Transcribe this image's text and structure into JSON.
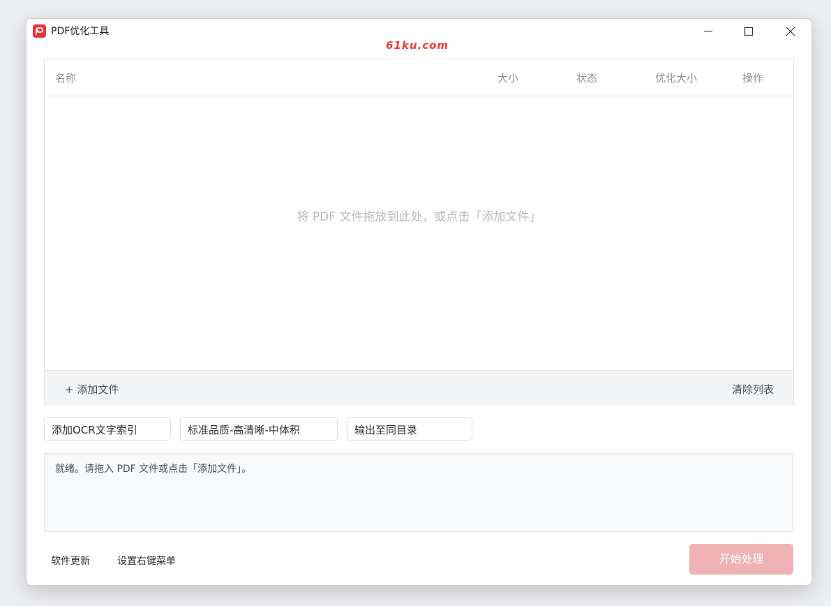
{
  "window": {
    "title": "PDF优化工具",
    "icon": "pdf-tool-logo",
    "watermark": "61ku.com"
  },
  "table": {
    "columns": [
      "名称",
      "大小",
      "状态",
      "优化大小",
      "操作"
    ],
    "rows": [],
    "empty_hint": "将 PDF 文件拖放到此处，或点击「添加文件」"
  },
  "list_actions": {
    "add_file": "+ 添加文件",
    "clear_list": "清除列表"
  },
  "options": {
    "ocr": "添加OCR文字索引",
    "quality": "标准品质-高清晰-中体积",
    "output": "输出至同目录"
  },
  "log": {
    "message": "就绪。请拖入 PDF 文件或点击「添加文件」。"
  },
  "footer": {
    "update_link": "软件更新",
    "context_menu_link": "设置右键菜单",
    "start_button": "开始处理",
    "start_enabled": false
  },
  "colors": {
    "brand": "#e8323c",
    "start_disabled": "#f0b3b5",
    "watermark": "#ef3b3b"
  }
}
